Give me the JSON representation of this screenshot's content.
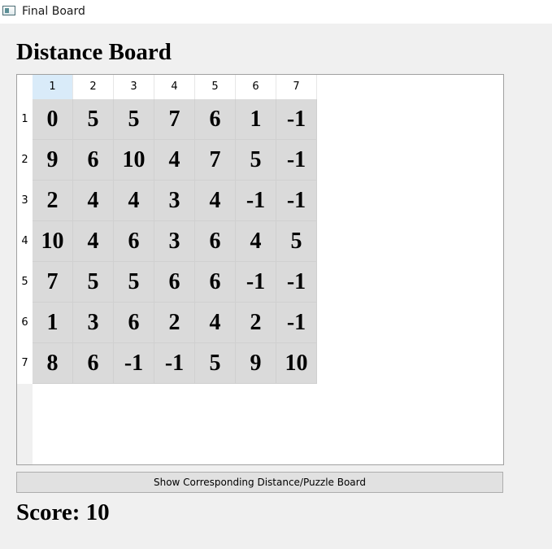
{
  "window": {
    "title": "Final Board",
    "icon": "app-window-icon"
  },
  "board": {
    "heading": "Distance Board",
    "column_headers": [
      "1",
      "2",
      "3",
      "4",
      "5",
      "6",
      "7"
    ],
    "selected_column": "1",
    "row_headers": [
      "1",
      "2",
      "3",
      "4",
      "5",
      "6",
      "7"
    ],
    "rows": [
      [
        "0",
        "5",
        "5",
        "7",
        "6",
        "1",
        "-1"
      ],
      [
        "9",
        "6",
        "10",
        "4",
        "7",
        "5",
        "-1"
      ],
      [
        "2",
        "4",
        "4",
        "3",
        "4",
        "-1",
        "-1"
      ],
      [
        "10",
        "4",
        "6",
        "3",
        "6",
        "4",
        "5"
      ],
      [
        "7",
        "5",
        "5",
        "6",
        "6",
        "-1",
        "-1"
      ],
      [
        "1",
        "3",
        "6",
        "2",
        "4",
        "2",
        "-1"
      ],
      [
        "8",
        "6",
        "-1",
        "-1",
        "5",
        "9",
        "10"
      ]
    ]
  },
  "actions": {
    "toggle_button_label": "Show Corresponding Distance/Puzzle Board"
  },
  "status": {
    "score_text": "Score: 10"
  },
  "colors": {
    "cell_background": "#dadada",
    "selected_header": "#d9ebf9",
    "window_background": "#f0f0f0"
  }
}
